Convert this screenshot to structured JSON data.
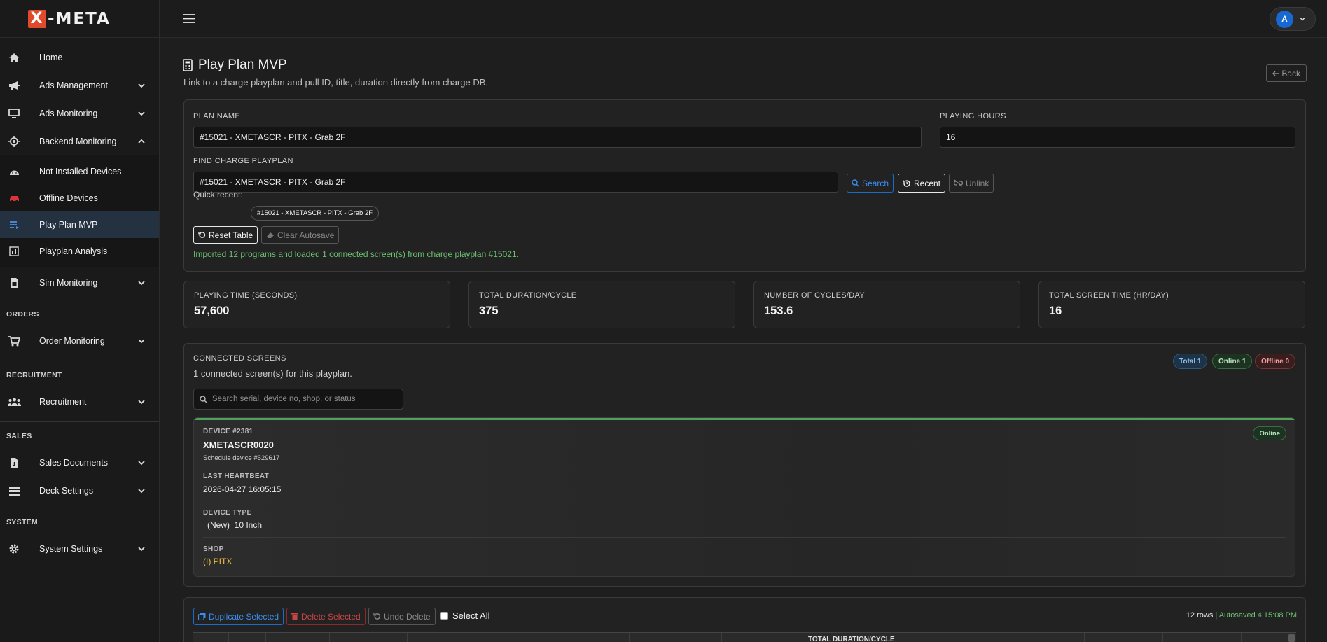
{
  "brand": {
    "logo_mark": "X",
    "logo_text": "-META"
  },
  "sidebar": {
    "items": [
      {
        "label": "Home",
        "icon": "home-icon"
      },
      {
        "label": "Ads Management",
        "icon": "megaphone-icon"
      },
      {
        "label": "Ads Monitoring",
        "icon": "monitor-icon"
      },
      {
        "label": "Backend Monitoring",
        "icon": "cpu-icon"
      }
    ],
    "sub_items": [
      {
        "label": "Not Installed Devices",
        "icon": "android-icon"
      },
      {
        "label": "Offline Devices",
        "icon": "car-icon"
      },
      {
        "label": "Play Plan MVP",
        "icon": "list-icon"
      },
      {
        "label": "Playplan Analysis",
        "icon": "chart-icon"
      }
    ],
    "sim": {
      "label": "Sim Monitoring",
      "icon": "sim-card-icon"
    },
    "orders_head": "ORDERS",
    "order_monitoring": {
      "label": "Order Monitoring",
      "icon": "cart-icon"
    },
    "recruitment_head": "RECRUITMENT",
    "recruitment": {
      "label": "Recruitment",
      "icon": "people-icon"
    },
    "sales_head": "SALES",
    "sales_documents": {
      "label": "Sales Documents",
      "icon": "document-icon"
    },
    "deck_settings": {
      "label": "Deck Settings",
      "icon": "layers-icon"
    },
    "system_head": "SYSTEM",
    "system_settings": {
      "label": "System Settings",
      "icon": "gear-icon"
    }
  },
  "topbar": {
    "avatar_initial": "A"
  },
  "page": {
    "title": "Play Plan MVP",
    "subtitle": "Link to a charge playplan and pull ID, title, duration directly from charge DB.",
    "back_label": "Back"
  },
  "form": {
    "plan_name_label": "PLAN NAME",
    "plan_name_value": "#15021 - XMETASCR - PITX - Grab 2F",
    "playing_hours_label": "PLAYING HOURS",
    "playing_hours_value": "16",
    "find_label": "FIND CHARGE PLAYPLAN",
    "find_value": "#15021 - XMETASCR - PITX - Grab 2F",
    "search_btn": "Search",
    "recent_btn": "Recent",
    "unlink_btn": "Unlink",
    "quick_recent_label": "Quick recent:",
    "quick_recent_chip": "#15021 - XMETASCR - PITX - Grab 2F",
    "reset_btn": "Reset Table",
    "clear_btn": "Clear Autosave",
    "success_msg": "Imported 12 programs and loaded 1 connected screen(s) from charge playplan #15021."
  },
  "stats": [
    {
      "title": "PLAYING TIME (SECONDS)",
      "value": "57,600"
    },
    {
      "title": "TOTAL DURATION/CYCLE",
      "value": "375"
    },
    {
      "title": "NUMBER OF CYCLES/DAY",
      "value": "153.6"
    },
    {
      "title": "TOTAL SCREEN TIME (HR/DAY)",
      "value": "16"
    }
  ],
  "screens": {
    "title": "CONNECTED SCREENS",
    "subtitle": "1 connected screen(s) for this playplan.",
    "badge_total": "Total 1",
    "badge_online": "Online 1",
    "badge_offline": "Offline 0",
    "search_placeholder": "Search serial, device no, shop, or status",
    "device": {
      "device_no": "DEVICE #2381",
      "serial": "XMETASCR0020",
      "schedule": "Schedule device #529617",
      "status": "Online",
      "heartbeat_label": "LAST HEARTBEAT",
      "heartbeat_value": "2026-04-27 16:05:15",
      "type_label": "DEVICE TYPE",
      "type_value": "(New)  10 Inch",
      "shop_label": "SHOP",
      "shop_value": "(I) PITX"
    }
  },
  "table_toolbar": {
    "duplicate_btn": "Duplicate Selected",
    "delete_btn": "Delete Selected",
    "undo_btn": "Undo Delete",
    "select_all": "Select All",
    "rows_count": "12 rows",
    "separator": "|",
    "autosaved": "Autosaved 4:15:08 PM",
    "partial_header": "TOTAL DURATION/CYCLE"
  },
  "colors": {
    "accent": "#1769d1",
    "success": "#6cc070",
    "logo": "#e04a2b"
  }
}
